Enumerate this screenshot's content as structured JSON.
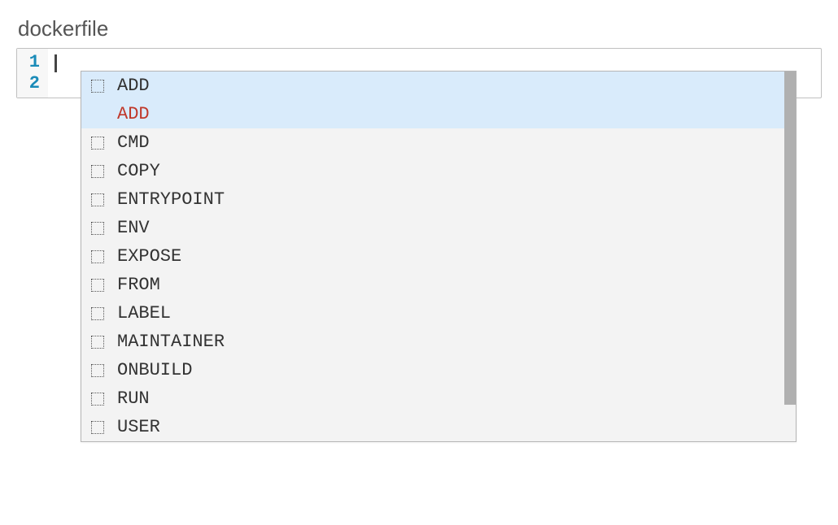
{
  "filename": "dockerfile",
  "gutter": {
    "lines": [
      "1",
      "2"
    ]
  },
  "autocomplete": {
    "selected_index": 0,
    "detail_text": "ADD",
    "items": [
      {
        "label": "ADD"
      },
      {
        "label": "CMD"
      },
      {
        "label": "COPY"
      },
      {
        "label": "ENTRYPOINT"
      },
      {
        "label": "ENV"
      },
      {
        "label": "EXPOSE"
      },
      {
        "label": "FROM"
      },
      {
        "label": "LABEL"
      },
      {
        "label": "MAINTAINER"
      },
      {
        "label": "ONBUILD"
      },
      {
        "label": "RUN"
      },
      {
        "label": "USER"
      }
    ]
  }
}
